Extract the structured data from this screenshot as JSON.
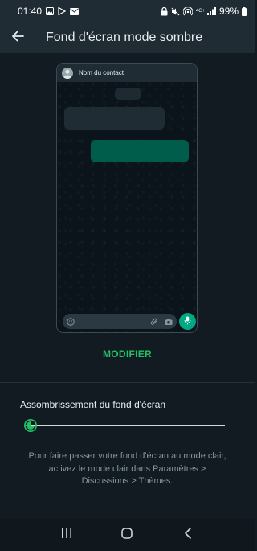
{
  "status_bar": {
    "time": "01:40",
    "network_label": "4G+",
    "battery": "99%"
  },
  "app_bar": {
    "title": "Fond d'écran mode sombre",
    "back_icon": "arrow-left-icon"
  },
  "preview": {
    "contact_name": "Nom du contact",
    "colors": {
      "incoming_bubble": "#1f2c34",
      "outgoing_bubble": "#005c4b",
      "mic_button": "#00a884"
    }
  },
  "actions": {
    "modifier_label": "MODIFIER"
  },
  "dimming": {
    "label": "Assombrissement du fond d'écran",
    "value_fraction": 0.03
  },
  "help": {
    "text": "Pour faire passer votre fond d'écran au mode clair, activez le mode clair dans Paramètres > Discussions > Thèmes."
  },
  "colors": {
    "accent": "#21c063",
    "background": "#121b22",
    "bar": "#1f2c34"
  },
  "nav": {
    "icons": [
      "recent-apps-icon",
      "home-icon",
      "back-icon"
    ]
  }
}
